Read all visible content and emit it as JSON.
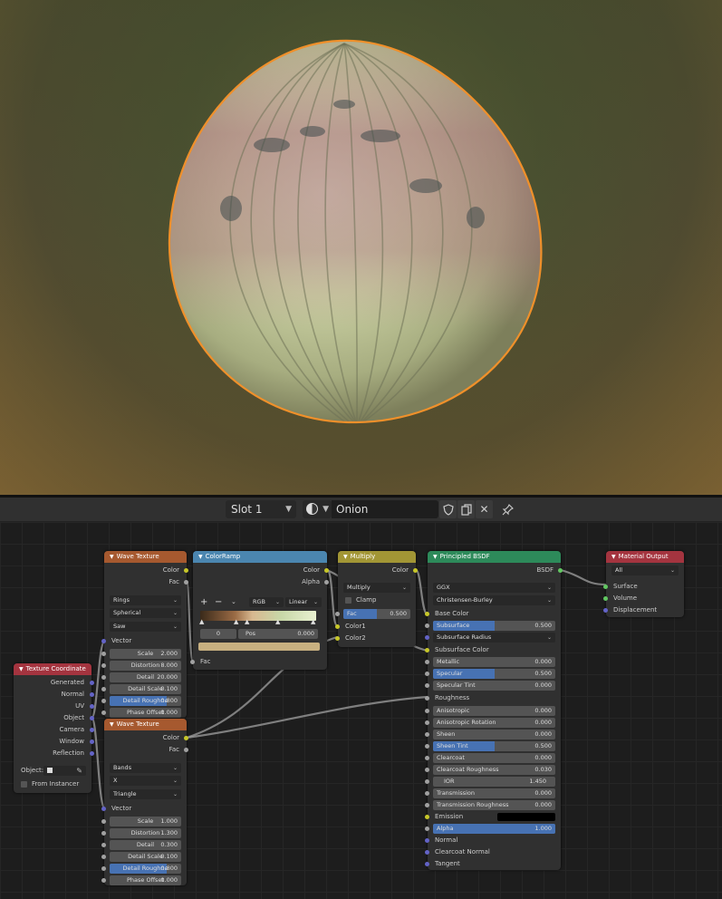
{
  "colors": {
    "accent": "#4772b3",
    "wave_header": "#a6592f",
    "colorramp_header": "#4b86b0",
    "multiply_header": "#a29635",
    "principled_header": "#2d8a5a",
    "output_header": "#a4343f",
    "selection_outline": "#f0902a"
  },
  "header": {
    "slot": "Slot 1",
    "material_name": "Onion",
    "icons": [
      "material-sphere-icon",
      "fake-user-shield-icon",
      "duplicate-icon",
      "close-icon",
      "pin-icon"
    ]
  },
  "nodes": {
    "tex_coord": {
      "title": "Texture Coordinate",
      "outputs": [
        "Generated",
        "Normal",
        "UV",
        "Object",
        "Camera",
        "Window",
        "Reflection"
      ],
      "object_label": "Object:",
      "from_instancer": "From Instancer"
    },
    "wave1": {
      "title": "Wave Texture",
      "outputs": [
        "Color",
        "Fac"
      ],
      "type": "Rings",
      "direction": "Spherical",
      "profile": "Saw",
      "vector": "Vector",
      "fields": [
        {
          "label": "Scale",
          "value": "2.000"
        },
        {
          "label": "Distortion",
          "value": "8.000"
        },
        {
          "label": "Detail",
          "value": "20.000"
        },
        {
          "label": "Detail Scale",
          "value": "0.100"
        },
        {
          "label": "Detail Roughne",
          "value": "0.800",
          "fill": 0.8
        },
        {
          "label": "Phase Offset",
          "value": "0.000"
        }
      ]
    },
    "wave2": {
      "title": "Wave Texture",
      "outputs": [
        "Color",
        "Fac"
      ],
      "type": "Bands",
      "direction": "X",
      "profile": "Triangle",
      "vector": "Vector",
      "fields": [
        {
          "label": "Scale",
          "value": "1.000"
        },
        {
          "label": "Distortion",
          "value": "1.300"
        },
        {
          "label": "Detail",
          "value": "0.300"
        },
        {
          "label": "Detail Scale",
          "value": "0.100"
        },
        {
          "label": "Detail Roughne",
          "value": "0.800",
          "fill": 0.8
        },
        {
          "label": "Phase Offset",
          "value": "0.000"
        }
      ]
    },
    "colorramp": {
      "title": "ColorRamp",
      "outputs": [
        "Color",
        "Alpha"
      ],
      "plus": "+",
      "minus": "−",
      "mode": "RGB",
      "interp": "Linear",
      "index": "0",
      "pos_label": "Pos",
      "pos_value": "0.000",
      "fac": "Fac"
    },
    "multiply": {
      "title": "Multiply",
      "output": "Color",
      "blend": "Multiply",
      "clamp": "Clamp",
      "fac_label": "Fac",
      "fac_value": "0.500",
      "inputs": [
        "Color1",
        "Color2"
      ]
    },
    "principled": {
      "title": "Principled BSDF",
      "output": "BSDF",
      "distribution": "GGX",
      "sss_method": "Christensen-Burley",
      "base_color": "Base Color",
      "subsurface": {
        "label": "Subsurface",
        "value": "0.500",
        "fill": 0.5
      },
      "subsurface_radius": "Subsurface Radius",
      "subsurface_color": "Subsurface Color",
      "metallic": {
        "label": "Metallic",
        "value": "0.000"
      },
      "specular": {
        "label": "Specular",
        "value": "0.500",
        "fill": 0.5
      },
      "specular_tint": {
        "label": "Specular Tint",
        "value": "0.000"
      },
      "roughness": "Roughness",
      "anisotropic": {
        "label": "Anisotropic",
        "value": "0.000"
      },
      "aniso_rot": {
        "label": "Anisotropic Rotation",
        "value": "0.000"
      },
      "sheen": {
        "label": "Sheen",
        "value": "0.000"
      },
      "sheen_tint": {
        "label": "Sheen Tint",
        "value": "0.500",
        "fill": 0.5
      },
      "clearcoat": {
        "label": "Clearcoat",
        "value": "0.000"
      },
      "clearcoat_rough": {
        "label": "Clearcoat Roughness",
        "value": "0.030"
      },
      "ior": {
        "label": "IOR",
        "value": "1.450"
      },
      "transmission": {
        "label": "Transmission",
        "value": "0.000"
      },
      "trans_rough": {
        "label": "Transmission Roughness",
        "value": "0.000"
      },
      "emission": "Emission",
      "alpha": {
        "label": "Alpha",
        "value": "1.000",
        "fill": 1.0
      },
      "normal": "Normal",
      "clearcoat_normal": "Clearcoat Normal",
      "tangent": "Tangent"
    },
    "output": {
      "title": "Material Output",
      "target": "All",
      "inputs": [
        "Surface",
        "Volume",
        "Displacement"
      ]
    }
  }
}
